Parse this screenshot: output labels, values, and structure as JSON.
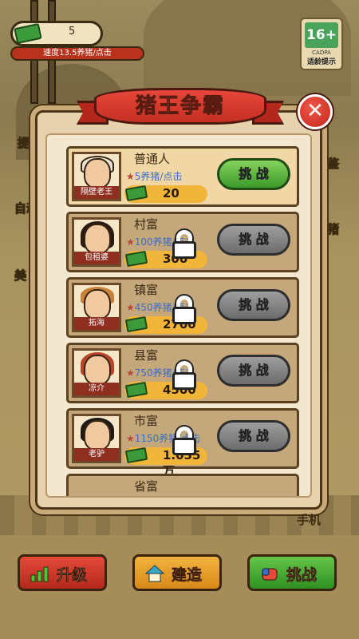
{
  "hud": {
    "money": "5",
    "speed": "速度13.5养猪/点击",
    "age_rating": "16+",
    "rating_brand": "CADPA",
    "rating_tip": "适龄提示"
  },
  "side_peeks": [
    "提",
    "自动",
    "美",
    "鉴",
    "猪",
    "手机"
  ],
  "dialog": {
    "title": "猪王争霸",
    "close_icon": "close-x-icon"
  },
  "ranks": [
    {
      "title": "普通人",
      "npc": "隔壁老王",
      "speed": "5养猪/点击",
      "cost": "20",
      "button": "挑 战",
      "locked": false
    },
    {
      "title": "村富",
      "npc": "包租婆",
      "speed": "100养猪/点击",
      "cost": "300",
      "button": "挑 战",
      "locked": true
    },
    {
      "title": "镇富",
      "npc": "拓海",
      "speed": "450养猪/点击",
      "cost": "2700",
      "button": "挑 战",
      "locked": true
    },
    {
      "title": "县富",
      "npc": "凉介",
      "speed": "750养猪/点击",
      "cost": "4500",
      "button": "挑 战",
      "locked": true
    },
    {
      "title": "市富",
      "npc": "老驴",
      "speed": "1150养猪/点击",
      "cost": "1.035万",
      "button": "挑 战",
      "locked": true
    },
    {
      "title": "省富",
      "npc": "",
      "speed": "",
      "cost": "",
      "button": "",
      "locked": true
    }
  ],
  "bottom_nav": {
    "upgrade": "升级",
    "build": "建造",
    "challenge": "挑战",
    "side_label": "手机"
  },
  "colors": {
    "ribbon": "#c42f22",
    "active_button": "#3b9a2a",
    "disabled_button": "#6c6c6c",
    "speed_text": "#3a6fc8"
  }
}
